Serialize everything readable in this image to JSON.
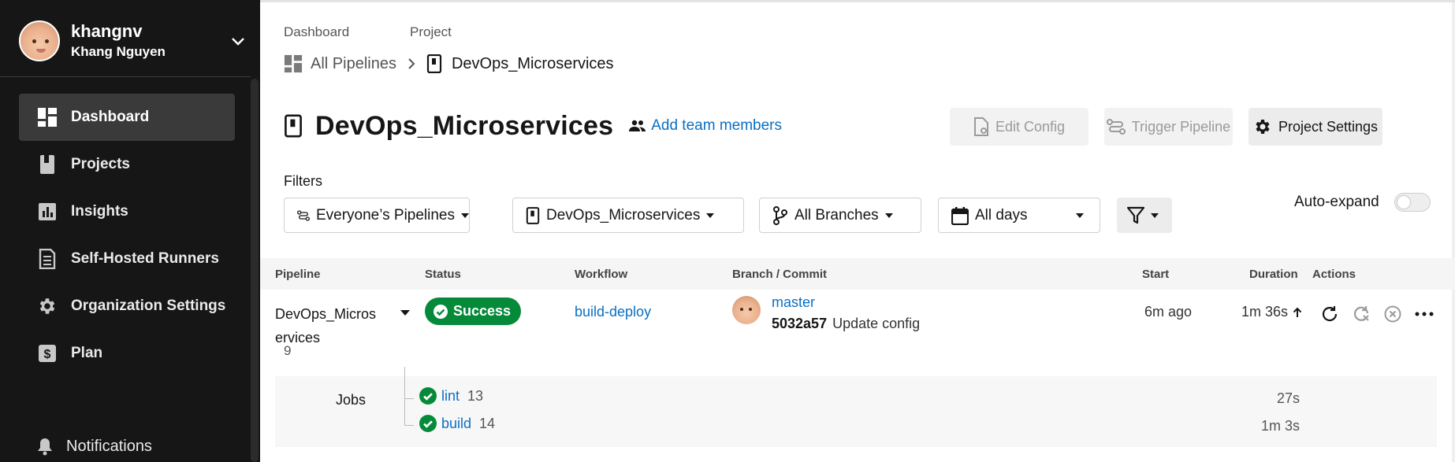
{
  "user": {
    "handle": "khangnv",
    "name": "Khang Nguyen"
  },
  "sidebar": {
    "items": [
      {
        "label": "Dashboard",
        "icon": "dashboard-icon",
        "active": true
      },
      {
        "label": "Projects",
        "icon": "book-icon"
      },
      {
        "label": "Insights",
        "icon": "insights-icon"
      },
      {
        "label": "Self-Hosted Runners",
        "icon": "runner-icon"
      },
      {
        "label": "Organization Settings",
        "icon": "gear-icon"
      },
      {
        "label": "Plan",
        "icon": "dollar-icon"
      }
    ],
    "notifications": "Notifications"
  },
  "breadcrumb": {
    "dashboard_label": "Dashboard",
    "project_label": "Project",
    "all_pipelines": "All Pipelines",
    "project": "DevOps_Microservices"
  },
  "header": {
    "title": "DevOps_Microservices",
    "add_members": "Add team members",
    "edit_config": "Edit Config",
    "trigger_pipeline": "Trigger Pipeline",
    "project_settings": "Project Settings"
  },
  "filters": {
    "label": "Filters",
    "pipelines": "Everyone’s Pipelines",
    "project": "DevOps_Microservices",
    "branches": "All Branches",
    "days": "All days",
    "auto_expand": "Auto-expand",
    "auto_expand_on": false
  },
  "table": {
    "headers": {
      "pipeline": "Pipeline",
      "status": "Status",
      "workflow": "Workflow",
      "branch_commit": "Branch / Commit",
      "start": "Start",
      "duration": "Duration",
      "actions": "Actions"
    },
    "rows": [
      {
        "pipeline_line1": "DevOps_Micros",
        "pipeline_line2": "ervices",
        "number": "9",
        "status": "Success",
        "workflow": "build-deploy",
        "branch": "master",
        "commit_hash": "5032a57",
        "commit_msg": "Update config",
        "start": "6m ago",
        "duration": "1m 36s"
      }
    ]
  },
  "jobs": {
    "label": "Jobs",
    "items": [
      {
        "name": "lint",
        "number": "13",
        "duration": "27s"
      },
      {
        "name": "build",
        "number": "14",
        "duration": "1m 3s"
      }
    ]
  },
  "colors": {
    "sidebar_bg": "#161616",
    "success": "#058a3a",
    "link": "#0a6fc2"
  }
}
